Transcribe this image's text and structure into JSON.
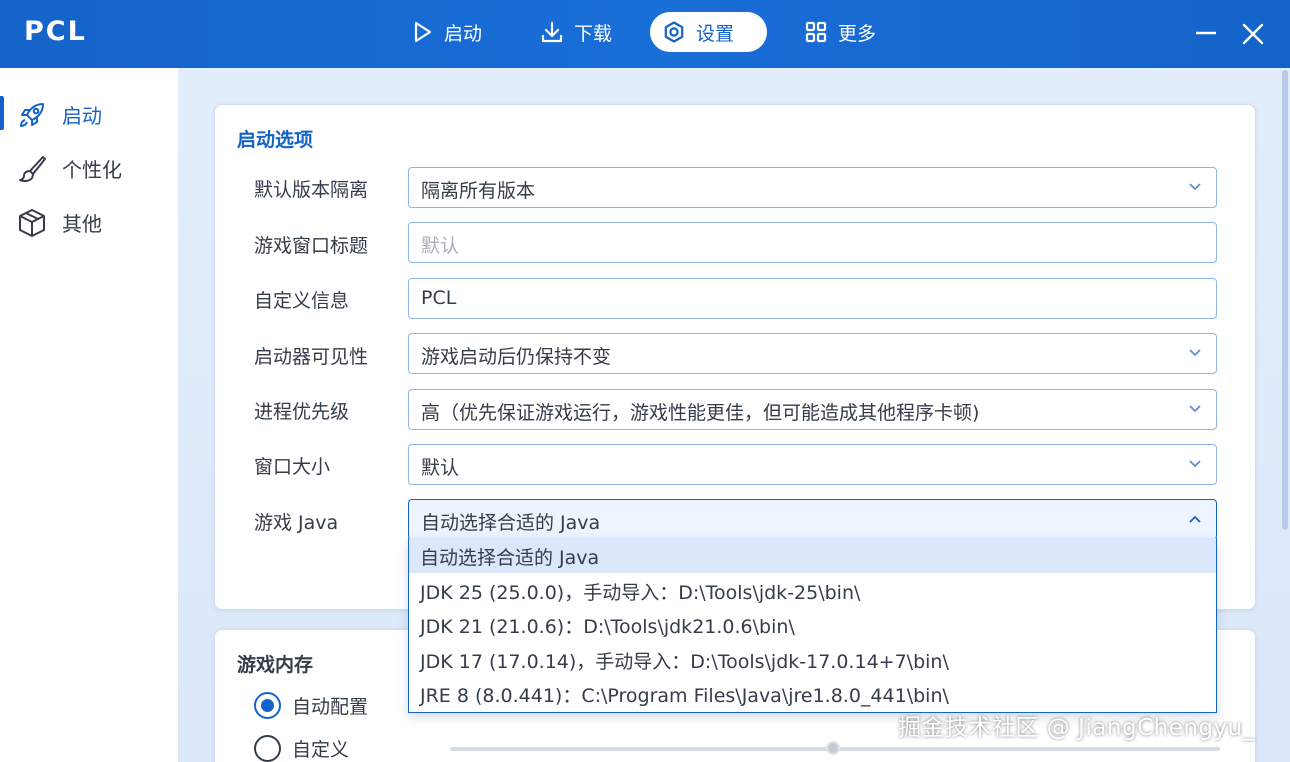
{
  "app": {
    "logo": "PCL"
  },
  "nav": [
    {
      "label": "启动",
      "icon": "play-icon"
    },
    {
      "label": "下载",
      "icon": "download-icon"
    },
    {
      "label": "设置",
      "icon": "settings-icon"
    },
    {
      "label": "更多",
      "icon": "grid-icon"
    }
  ],
  "nav_active": "设置",
  "sidebar": {
    "items": [
      {
        "label": "启动",
        "icon": "rocket-icon"
      },
      {
        "label": "个性化",
        "icon": "brush-icon"
      },
      {
        "label": "其他",
        "icon": "box-icon"
      }
    ],
    "active": "启动"
  },
  "launch_options": {
    "title": "启动选项",
    "rows": [
      {
        "label": "默认版本隔离",
        "value": "隔离所有版本",
        "kind": "select"
      },
      {
        "label": "游戏窗口标题",
        "placeholder": "默认",
        "kind": "text"
      },
      {
        "label": "自定义信息",
        "value": "PCL",
        "kind": "text"
      },
      {
        "label": "启动器可见性",
        "value": "游戏启动后仍保持不变",
        "kind": "select"
      },
      {
        "label": "进程优先级",
        "value": "高（优先保证游戏运行，游戏性能更佳，但可能造成其他程序卡顿)",
        "kind": "select"
      },
      {
        "label": "窗口大小",
        "value": "默认",
        "kind": "select"
      },
      {
        "label": "游戏 Java",
        "value": "自动选择合适的 Java",
        "kind": "select-open"
      }
    ],
    "java_options": [
      "自动选择合适的 Java",
      "JDK 25 (25.0.0)，手动导入：D:\\Tools\\jdk-25\\bin\\",
      "JDK 21 (21.0.6)：D:\\Tools\\jdk21.0.6\\bin\\",
      "JDK 17 (17.0.14)，手动导入：D:\\Tools\\jdk-17.0.14+7\\bin\\",
      "JRE 8 (8.0.441)：C:\\Program Files\\Java\\jre1.8.0_441\\bin\\"
    ],
    "java_selected_index": 0
  },
  "game_memory": {
    "title": "游戏内存",
    "options": [
      "自动配置",
      "自定义"
    ],
    "selected": "自动配置"
  },
  "watermark": "掘金技术社区 @ JiangChengyu_",
  "colors": {
    "accent": "#1463c9",
    "title_bar": "#1a6ed8",
    "text": "#343d4a"
  }
}
